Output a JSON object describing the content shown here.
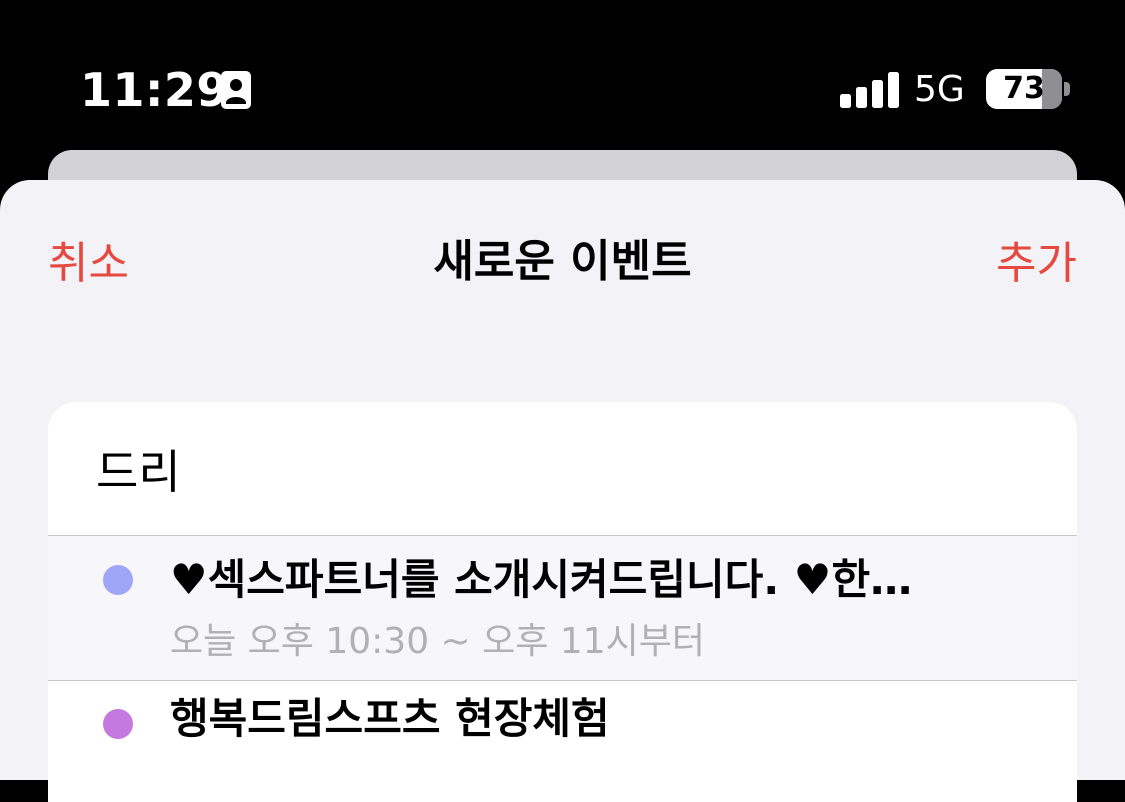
{
  "status_bar": {
    "time": "11:29",
    "network": "5G",
    "battery": "73",
    "icons": [
      "person-badge-icon",
      "signal-icon",
      "battery-icon"
    ]
  },
  "nav": {
    "cancel_label": "취소",
    "title": "새로운 이벤트",
    "add_label": "추가"
  },
  "form": {
    "title_value": "드리"
  },
  "suggestions": [
    {
      "title": "♥섹스파트너를 소개시켜드립니다. ♥한…",
      "subtitle": "오늘 오후 10:30 ~ 오후 11시부터",
      "color": "#a1a5f7"
    },
    {
      "title": "행복드림스프츠 현장체험",
      "subtitle": "",
      "color": "#c478e0"
    }
  ],
  "colors": {
    "accent": "#e5493f",
    "sheet_background": "#f2f2f7"
  }
}
